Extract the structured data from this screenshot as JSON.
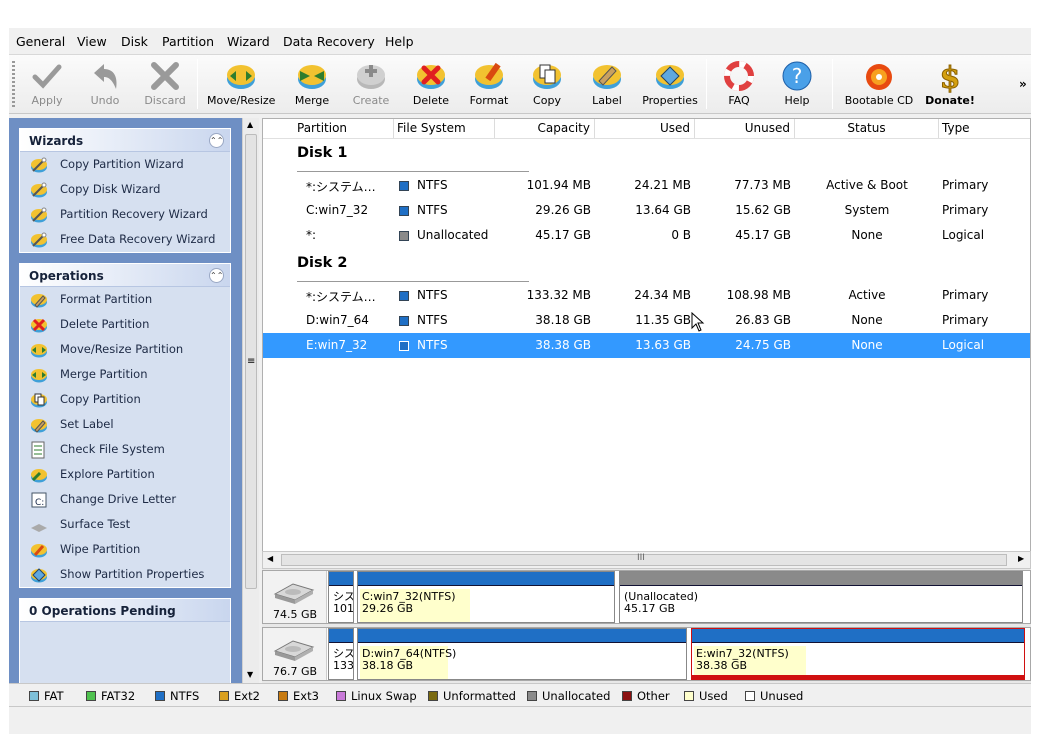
{
  "menu": [
    "General",
    "View",
    "Disk",
    "Partition",
    "Wizard",
    "Data Recovery",
    "Help"
  ],
  "toolbar": {
    "apply": "Apply",
    "undo": "Undo",
    "discard": "Discard",
    "move_resize": "Move/Resize",
    "merge": "Merge",
    "create": "Create",
    "delete": "Delete",
    "format": "Format",
    "copy": "Copy",
    "label": "Label",
    "properties": "Properties",
    "faq": "FAQ",
    "help": "Help",
    "bootable_cd": "Bootable CD",
    "donate": "Donate!",
    "more": "»"
  },
  "wizards": {
    "title": "Wizards",
    "items": [
      "Copy Partition Wizard",
      "Copy Disk Wizard",
      "Partition Recovery Wizard",
      "Free Data Recovery Wizard"
    ]
  },
  "operations": {
    "title": "Operations",
    "items": [
      "Format Partition",
      "Delete Partition",
      "Move/Resize Partition",
      "Merge Partition",
      "Copy Partition",
      "Set Label",
      "Check File System",
      "Explore Partition",
      "Change Drive Letter",
      "Surface Test",
      "Wipe Partition",
      "Show Partition Properties"
    ]
  },
  "pending": {
    "title": "0 Operations Pending"
  },
  "columns": [
    "Partition",
    "File System",
    "Capacity",
    "Used",
    "Unused",
    "Status",
    "Type"
  ],
  "disks": [
    {
      "title": "Disk 1",
      "rows": [
        {
          "partition": "*:システム…",
          "fs": "NTFS",
          "capacity": "101.94 MB",
          "used": "24.21 MB",
          "unused": "77.73 MB",
          "status": "Active & Boot",
          "type": "Primary"
        },
        {
          "partition": "C:win7_32",
          "fs": "NTFS",
          "capacity": "29.26 GB",
          "used": "13.64 GB",
          "unused": "15.62 GB",
          "status": "System",
          "type": "Primary"
        },
        {
          "partition": "*:",
          "fs": "Unallocated",
          "capacity": "45.17 GB",
          "used": "0 B",
          "unused": "45.17 GB",
          "status": "None",
          "type": "Logical"
        }
      ]
    },
    {
      "title": "Disk 2",
      "rows": [
        {
          "partition": "*:システム…",
          "fs": "NTFS",
          "capacity": "133.32 MB",
          "used": "24.34 MB",
          "unused": "108.98 MB",
          "status": "Active",
          "type": "Primary"
        },
        {
          "partition": "D:win7_64",
          "fs": "NTFS",
          "capacity": "38.18 GB",
          "used": "11.35 GB",
          "unused": "26.83 GB",
          "status": "None",
          "type": "Primary"
        },
        {
          "partition": "E:win7_32",
          "fs": "NTFS",
          "capacity": "38.38 GB",
          "used": "13.63 GB",
          "unused": "24.75 GB",
          "status": "None",
          "type": "Logical"
        }
      ]
    }
  ],
  "hscroll_grip": "III",
  "diskmap": [
    {
      "size": "74.5 GB",
      "segments": [
        {
          "label1": "シス",
          "label2": "101"
        },
        {
          "label1": "C:win7_32(NTFS)",
          "label2": "29.26 GB"
        },
        {
          "label1": "(Unallocated)",
          "label2": "45.17 GB"
        }
      ]
    },
    {
      "size": "76.7 GB",
      "segments": [
        {
          "label1": "シス",
          "label2": "133"
        },
        {
          "label1": "D:win7_64(NTFS)",
          "label2": "38.18 GB"
        },
        {
          "label1": "E:win7_32(NTFS)",
          "label2": "38.38 GB"
        }
      ]
    }
  ],
  "legend": [
    {
      "label": "FAT",
      "color": "#7fc1d9"
    },
    {
      "label": "FAT32",
      "color": "#4fc24f"
    },
    {
      "label": "NTFS",
      "color": "#1f6fc5"
    },
    {
      "label": "Ext2",
      "color": "#d9a020"
    },
    {
      "label": "Ext3",
      "color": "#c77a10"
    },
    {
      "label": "Linux Swap",
      "color": "#c97ad9"
    },
    {
      "label": "Unformatted",
      "color": "#7a6a10"
    },
    {
      "label": "Unallocated",
      "color": "#8a8a8a"
    },
    {
      "label": "Other",
      "color": "#8a1010"
    },
    {
      "label": "Used",
      "color": "#ffffcc"
    },
    {
      "label": "Unused",
      "color": "#ffffff"
    }
  ],
  "colors": {
    "selection": "#3399ff",
    "sidebar": "#6e8fc4",
    "panel": "#d6e0f0",
    "ntfs": "#1f6fc5"
  }
}
